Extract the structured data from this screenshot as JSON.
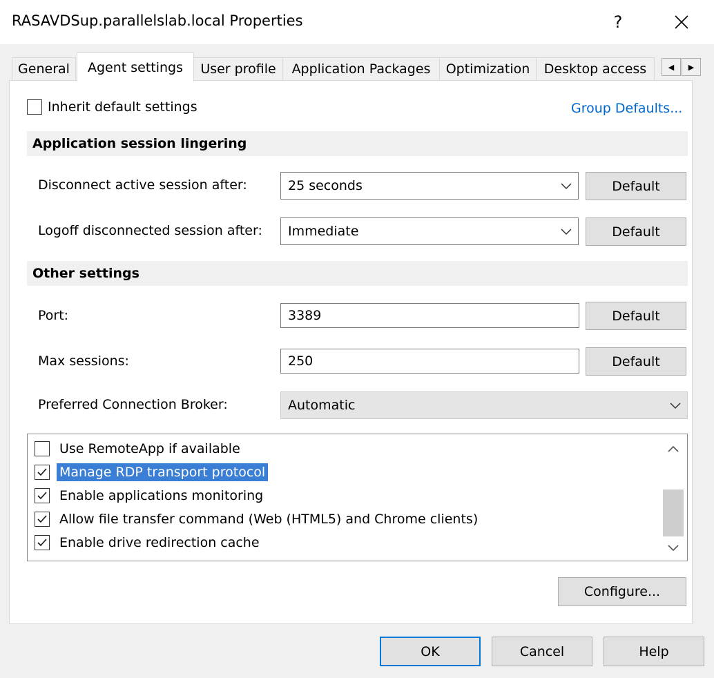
{
  "window": {
    "title": "RASAVDSup.parallelslab.local Properties",
    "help_label": "?",
    "close_label": "✕"
  },
  "tabs": [
    {
      "label": "General",
      "active": false
    },
    {
      "label": "Agent settings",
      "active": true
    },
    {
      "label": "User profile",
      "active": false
    },
    {
      "label": "Application Packages",
      "active": false
    },
    {
      "label": "Optimization",
      "active": false
    },
    {
      "label": "Desktop access",
      "active": false
    }
  ],
  "tab_scroll": {
    "left": "◀",
    "right": "▶"
  },
  "inherit": {
    "label": "Inherit default settings",
    "checked": false
  },
  "group_defaults_link": "Group Defaults...",
  "sections": {
    "lingering": "Application session lingering",
    "other": "Other settings"
  },
  "fields": {
    "disconnect": {
      "label": "Disconnect active session after:",
      "value": "25 seconds",
      "default_label": "Default"
    },
    "logoff": {
      "label": "Logoff disconnected session after:",
      "value": "Immediate",
      "default_label": "Default"
    },
    "port": {
      "label": "Port:",
      "value": "3389",
      "default_label": "Default"
    },
    "max_sessions": {
      "label": "Max sessions:",
      "value": "250",
      "default_label": "Default"
    },
    "broker": {
      "label": "Preferred Connection Broker:",
      "value": "Automatic"
    }
  },
  "options": [
    {
      "label": "Use RemoteApp if available",
      "checked": false,
      "selected": false
    },
    {
      "label": "Manage RDP transport protocol",
      "checked": true,
      "selected": true
    },
    {
      "label": "Enable applications monitoring",
      "checked": true,
      "selected": false
    },
    {
      "label": "Allow file transfer command (Web (HTML5) and Chrome clients)",
      "checked": true,
      "selected": false
    },
    {
      "label": "Enable drive redirection cache",
      "checked": true,
      "selected": false
    }
  ],
  "configure_label": "Configure...",
  "footer": {
    "ok": "OK",
    "cancel": "Cancel",
    "help": "Help"
  }
}
